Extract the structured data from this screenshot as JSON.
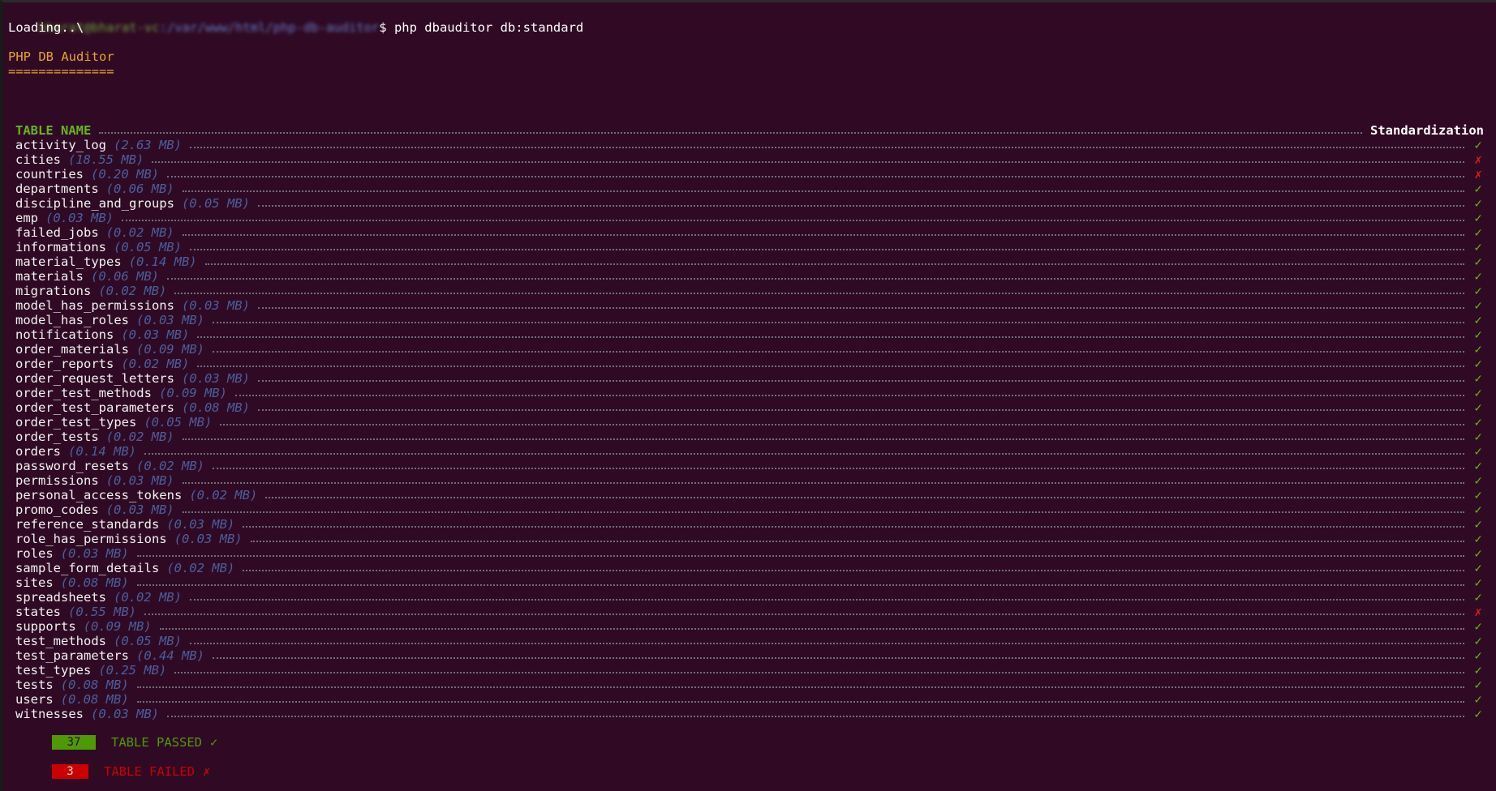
{
  "prompt": {
    "user_host": "bharat@bharat-vc",
    "path": ":/var/www/html/php-db-auditor",
    "symbol": "$"
  },
  "command": "php dbauditor db:standard",
  "loading": "Loading..\\",
  "app_title": "PHP DB Auditor",
  "title_underline": "==============",
  "table_header": {
    "left": "TABLE NAME",
    "right": "Standardization"
  },
  "tables": [
    {
      "name": "activity_log",
      "size": "(2.63 MB)",
      "status": "pass",
      "mark": "✓"
    },
    {
      "name": "cities",
      "size": "(18.55 MB)",
      "status": "fail",
      "mark": "✗"
    },
    {
      "name": "countries",
      "size": "(0.20 MB)",
      "status": "fail",
      "mark": "✗"
    },
    {
      "name": "departments",
      "size": "(0.06 MB)",
      "status": "pass",
      "mark": "✓"
    },
    {
      "name": "discipline_and_groups",
      "size": "(0.05 MB)",
      "status": "pass",
      "mark": "✓"
    },
    {
      "name": "emp",
      "size": "(0.03 MB)",
      "status": "pass",
      "mark": "✓"
    },
    {
      "name": "failed_jobs",
      "size": "(0.02 MB)",
      "status": "pass",
      "mark": "✓"
    },
    {
      "name": "informations",
      "size": "(0.05 MB)",
      "status": "pass",
      "mark": "✓"
    },
    {
      "name": "material_types",
      "size": "(0.14 MB)",
      "status": "pass",
      "mark": "✓"
    },
    {
      "name": "materials",
      "size": "(0.06 MB)",
      "status": "pass",
      "mark": "✓"
    },
    {
      "name": "migrations",
      "size": "(0.02 MB)",
      "status": "pass",
      "mark": "✓"
    },
    {
      "name": "model_has_permissions",
      "size": "(0.03 MB)",
      "status": "pass",
      "mark": "✓"
    },
    {
      "name": "model_has_roles",
      "size": "(0.03 MB)",
      "status": "pass",
      "mark": "✓"
    },
    {
      "name": "notifications",
      "size": "(0.03 MB)",
      "status": "pass",
      "mark": "✓"
    },
    {
      "name": "order_materials",
      "size": "(0.09 MB)",
      "status": "pass",
      "mark": "✓"
    },
    {
      "name": "order_reports",
      "size": "(0.02 MB)",
      "status": "pass",
      "mark": "✓"
    },
    {
      "name": "order_request_letters",
      "size": "(0.03 MB)",
      "status": "pass",
      "mark": "✓"
    },
    {
      "name": "order_test_methods",
      "size": "(0.09 MB)",
      "status": "pass",
      "mark": "✓"
    },
    {
      "name": "order_test_parameters",
      "size": "(0.08 MB)",
      "status": "pass",
      "mark": "✓"
    },
    {
      "name": "order_test_types",
      "size": "(0.05 MB)",
      "status": "pass",
      "mark": "✓"
    },
    {
      "name": "order_tests",
      "size": "(0.02 MB)",
      "status": "pass",
      "mark": "✓"
    },
    {
      "name": "orders",
      "size": "(0.14 MB)",
      "status": "pass",
      "mark": "✓"
    },
    {
      "name": "password_resets",
      "size": "(0.02 MB)",
      "status": "pass",
      "mark": "✓"
    },
    {
      "name": "permissions",
      "size": "(0.03 MB)",
      "status": "pass",
      "mark": "✓"
    },
    {
      "name": "personal_access_tokens",
      "size": "(0.02 MB)",
      "status": "pass",
      "mark": "✓"
    },
    {
      "name": "promo_codes",
      "size": "(0.03 MB)",
      "status": "pass",
      "mark": "✓"
    },
    {
      "name": "reference_standards",
      "size": "(0.03 MB)",
      "status": "pass",
      "mark": "✓"
    },
    {
      "name": "role_has_permissions",
      "size": "(0.03 MB)",
      "status": "pass",
      "mark": "✓"
    },
    {
      "name": "roles",
      "size": "(0.03 MB)",
      "status": "pass",
      "mark": "✓"
    },
    {
      "name": "sample_form_details",
      "size": "(0.02 MB)",
      "status": "pass",
      "mark": "✓"
    },
    {
      "name": "sites",
      "size": "(0.08 MB)",
      "status": "pass",
      "mark": "✓"
    },
    {
      "name": "spreadsheets",
      "size": "(0.02 MB)",
      "status": "pass",
      "mark": "✓"
    },
    {
      "name": "states",
      "size": "(0.55 MB)",
      "status": "fail",
      "mark": "✗"
    },
    {
      "name": "supports",
      "size": "(0.09 MB)",
      "status": "pass",
      "mark": "✓"
    },
    {
      "name": "test_methods",
      "size": "(0.05 MB)",
      "status": "pass",
      "mark": "✓"
    },
    {
      "name": "test_parameters",
      "size": "(0.44 MB)",
      "status": "pass",
      "mark": "✓"
    },
    {
      "name": "test_types",
      "size": "(0.25 MB)",
      "status": "pass",
      "mark": "✓"
    },
    {
      "name": "tests",
      "size": "(0.08 MB)",
      "status": "pass",
      "mark": "✓"
    },
    {
      "name": "users",
      "size": "(0.08 MB)",
      "status": "pass",
      "mark": "✓"
    },
    {
      "name": "witnesses",
      "size": "(0.03 MB)",
      "status": "pass",
      "mark": "✓"
    }
  ],
  "summary": {
    "passed_count": "37",
    "passed_label": "TABLE PASSED",
    "passed_mark": "✓",
    "failed_count": "3",
    "failed_label": "TABLE FAILED",
    "failed_mark": "✗"
  },
  "colors": {
    "background": "#300a24",
    "pass": "#67b51d",
    "fail": "#e01b1b",
    "title": "#e5a52a",
    "size_text": "#4a5fa0"
  }
}
